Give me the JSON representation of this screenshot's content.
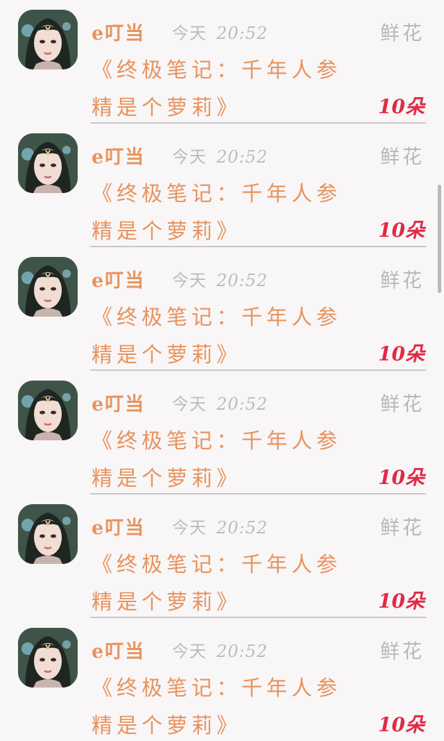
{
  "colors": {
    "name": "#e8935f",
    "title": "#e8935f",
    "time": "#bcbcbc",
    "gift_type": "#b8b8b8",
    "count": "#e02a45",
    "divider": "#c9c7c7",
    "background": "#f8f6f6"
  },
  "items": [
    {
      "avatar_icon": "user-avatar-icon",
      "name": "e叮当",
      "day": "今天",
      "time": "20:52",
      "gift_type": "鲜花",
      "title_line1": "《终极笔记：千年人参",
      "title_line2": "精是个萝莉》",
      "count": "10朵"
    },
    {
      "avatar_icon": "user-avatar-icon",
      "name": "e叮当",
      "day": "今天",
      "time": "20:52",
      "gift_type": "鲜花",
      "title_line1": "《终极笔记：千年人参",
      "title_line2": "精是个萝莉》",
      "count": "10朵"
    },
    {
      "avatar_icon": "user-avatar-icon",
      "name": "e叮当",
      "day": "今天",
      "time": "20:52",
      "gift_type": "鲜花",
      "title_line1": "《终极笔记：千年人参",
      "title_line2": "精是个萝莉》",
      "count": "10朵"
    },
    {
      "avatar_icon": "user-avatar-icon",
      "name": "e叮当",
      "day": "今天",
      "time": "20:52",
      "gift_type": "鲜花",
      "title_line1": "《终极笔记：千年人参",
      "title_line2": "精是个萝莉》",
      "count": "10朵"
    },
    {
      "avatar_icon": "user-avatar-icon",
      "name": "e叮当",
      "day": "今天",
      "time": "20:52",
      "gift_type": "鲜花",
      "title_line1": "《终极笔记：千年人参",
      "title_line2": "精是个萝莉》",
      "count": "10朵"
    },
    {
      "avatar_icon": "user-avatar-icon",
      "name": "e叮当",
      "day": "今天",
      "time": "20:52",
      "gift_type": "鲜花",
      "title_line1": "《终极笔记：千年人参",
      "title_line2": "精是个萝莉》",
      "count": "10朵"
    }
  ]
}
